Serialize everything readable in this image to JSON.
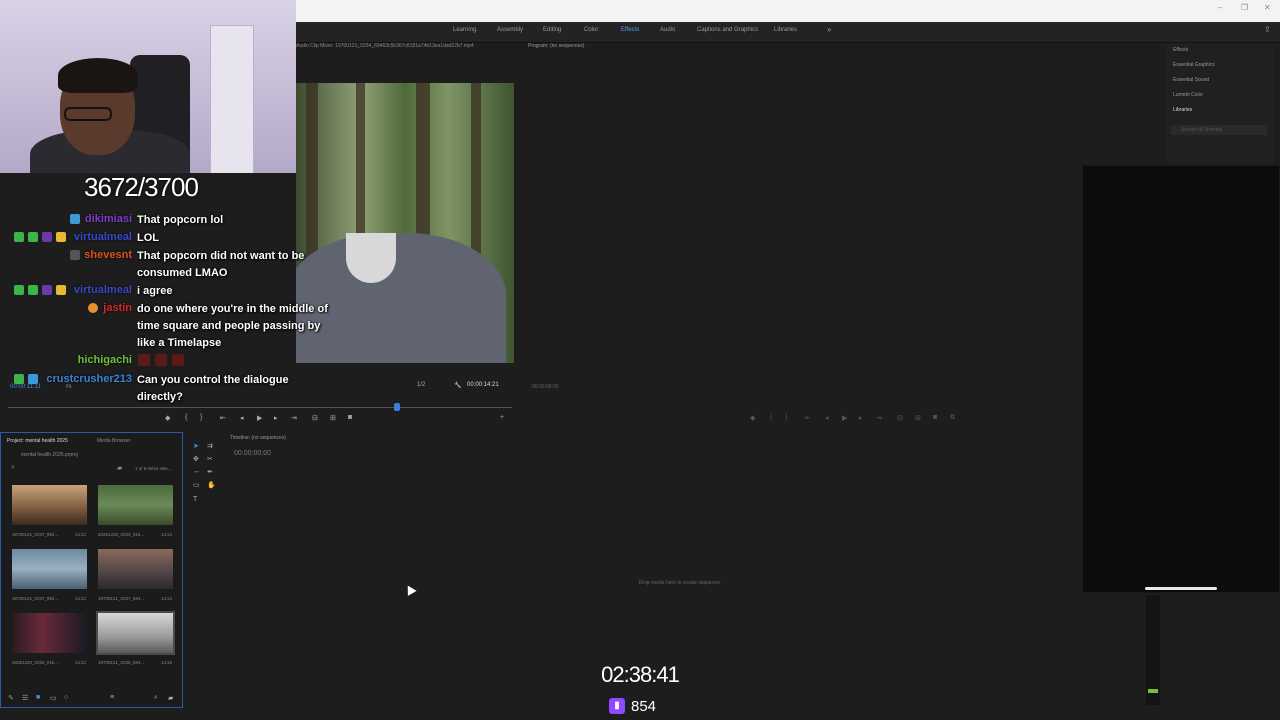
{
  "workspace_tabs": [
    "Learning",
    "Assembly",
    "Editing",
    "Color",
    "Effects",
    "Audio",
    "Captions and Graphics",
    "Libraries"
  ],
  "active_workspace": "Effects",
  "more_workspaces": "»",
  "source_monitor": {
    "header": "Audio Clip Mixer: 19700121_0234_69463c5b367c8191a74b13ea1dad22b7.mp4",
    "timecode_left": "00:00:11:11",
    "fit_label": "Fit",
    "zoom": "1/2",
    "timecode_right": "00:00:14:21"
  },
  "program_monitor": {
    "header": "Program: (no sequences)",
    "timecode": "00:00:00:00"
  },
  "right_panel": {
    "items": [
      "Effects",
      "Essential Graphics",
      "Essential Sound",
      "Lumetri Color",
      "Libraries"
    ],
    "search_placeholder": "Search all libraries"
  },
  "project_panel": {
    "tab_project": "Project: mental health 2025",
    "tab_media_browser": "Media Browser",
    "file_name": "mental health 2025.prproj",
    "selection_status": "1 of 6 items sele...",
    "thumbnails": [
      {
        "name": "19700121_0237_694...",
        "duration": "14:21"
      },
      {
        "name": "20251220_0244_01k...",
        "duration": "14:21"
      },
      {
        "name": "19700121_0237_694...",
        "duration": "14:21"
      },
      {
        "name": "19700121_0237_694...",
        "duration": "14:21"
      },
      {
        "name": "20251220_0255_01k...",
        "duration": "14:21"
      },
      {
        "name": "19700121_0236_694...",
        "duration": "14:22"
      }
    ]
  },
  "timeline": {
    "header": "Timeline: (no sequences)",
    "timecode": "00:00:00:00",
    "drop_hint": "Drop media here to create sequence."
  },
  "stream_overlay": {
    "sub_count": "3672/3700",
    "stream_time": "02:38:41",
    "viewer_count": "854",
    "chat": [
      {
        "name": "dikimiasi",
        "message": "That popcorn lol",
        "color": "#7c3cc8"
      },
      {
        "name": "virtualmeal",
        "message": "LOL",
        "color": "#3949c9"
      },
      {
        "name": "shevesnt",
        "message": "That popcorn did not want to be consumed LMAO",
        "color": "#d9541e"
      },
      {
        "name": "virtualmeal",
        "message": "i agree",
        "color": "#3949c9"
      },
      {
        "name": "jastin",
        "message": "do one where you're in the middle of time square and people passing by like a Timelapse",
        "color": "#d02a2a"
      },
      {
        "name": "hichigachi",
        "message": "",
        "color": "#6fbf3a"
      },
      {
        "name": "crustcrusher213",
        "message": "Can you control the dialogue directly?",
        "color": "#3b82d8"
      }
    ]
  }
}
